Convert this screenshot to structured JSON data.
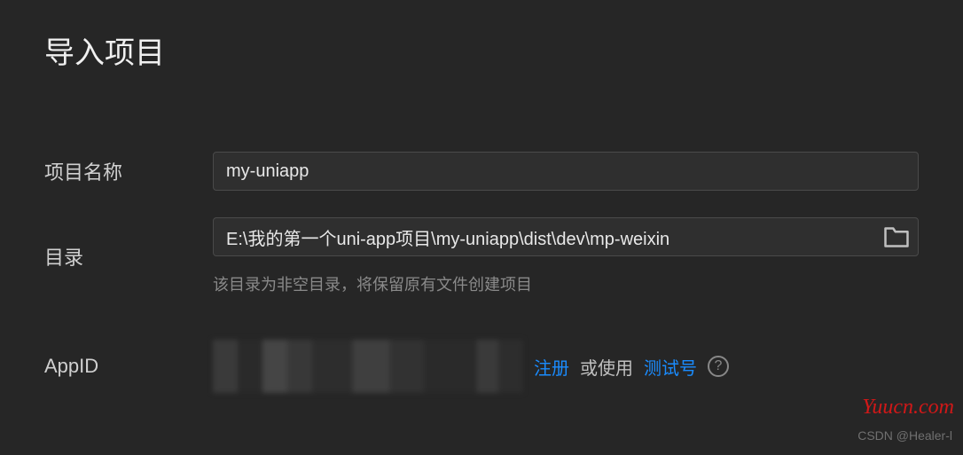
{
  "title": "导入项目",
  "fields": {
    "project_name": {
      "label": "项目名称",
      "value": "my-uniapp"
    },
    "directory": {
      "label": "目录",
      "value": "E:\\我的第一个uni-app项目\\my-uniapp\\dist\\dev\\mp-weixin",
      "helper": "该目录为非空目录，将保留原有文件创建项目"
    },
    "appid": {
      "label": "AppID",
      "register_link": "注册",
      "or_use_text": "或使用",
      "test_account_link": "测试号"
    }
  },
  "watermark": "Yuucn.com",
  "attribution": "CSDN @Healer-l"
}
